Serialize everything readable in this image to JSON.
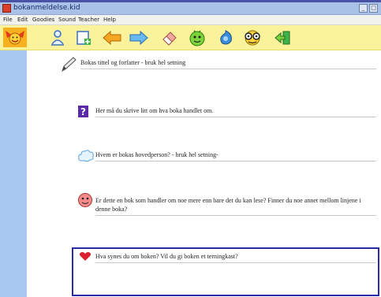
{
  "window": {
    "title": "bokanmeldelse.kid"
  },
  "menu": {
    "items": [
      "File",
      "Edit",
      "Goodies",
      "Sound",
      "Teacher",
      "Help"
    ]
  },
  "toolbar": {
    "tools": [
      "kidpix-logo-icon",
      "stamp-person-icon",
      "add-page-icon",
      "arrow-left-icon",
      "arrow-right-icon",
      "eraser-icon",
      "smiley-face-icon",
      "shell-icon",
      "glasses-face-icon",
      "exit-icon"
    ]
  },
  "questions": [
    {
      "icon": "pencil-icon",
      "text": "Bokas tittel og forfatter - bruk hel setning"
    },
    {
      "icon": "question-mark-icon",
      "text": "Her må du skrive litt om hva boka handlet om."
    },
    {
      "icon": "cloud-icon",
      "text": "Hvem er bokas hovedperson? - bruk hel setning-"
    },
    {
      "icon": "face-icon",
      "text": "Er dette en bok som handler om noe mere enn bare det du kan lese? Finner du noe annet mellom linjene i denne boka?"
    },
    {
      "icon": "heart-icon",
      "text": "Hva synes du om boken? Vil du gi boken et terningkast?"
    }
  ],
  "colors": {
    "toolbar_bg": "#fbf39b",
    "sidebar_bg": "#a9c9f3",
    "titlebar_bg": "#a9c0e7",
    "focus_border": "#2a2aa8"
  }
}
